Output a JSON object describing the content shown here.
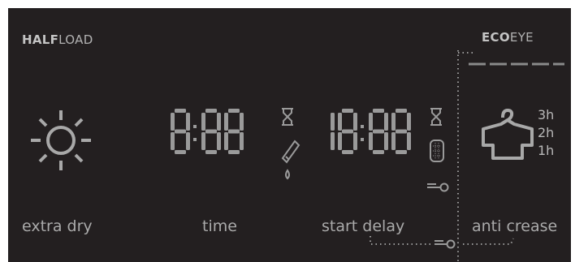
{
  "panel": {
    "half_load": {
      "strong": "HALF",
      "light": "LOAD"
    },
    "eco_eye": {
      "strong": "ECO",
      "light": "EYE"
    }
  },
  "controls": {
    "extra_dry": {
      "label": "extra dry",
      "icon": "sun-icon"
    },
    "time": {
      "label": "time",
      "display": "8:88"
    },
    "start_delay": {
      "label": "start delay",
      "display": "18:88"
    },
    "anti_crease": {
      "label": "anti crease",
      "icon": "shirt-icon",
      "levels": [
        "3h",
        "2h",
        "1h"
      ]
    }
  },
  "status_icons": [
    "hourglass-icon",
    "detergent-drop-icon",
    "hourglass-icon",
    "drum-icon",
    "key-icon"
  ],
  "colors": {
    "background": "#231f20",
    "segment": "#9a9a9a",
    "text": "#aaaaaa"
  }
}
